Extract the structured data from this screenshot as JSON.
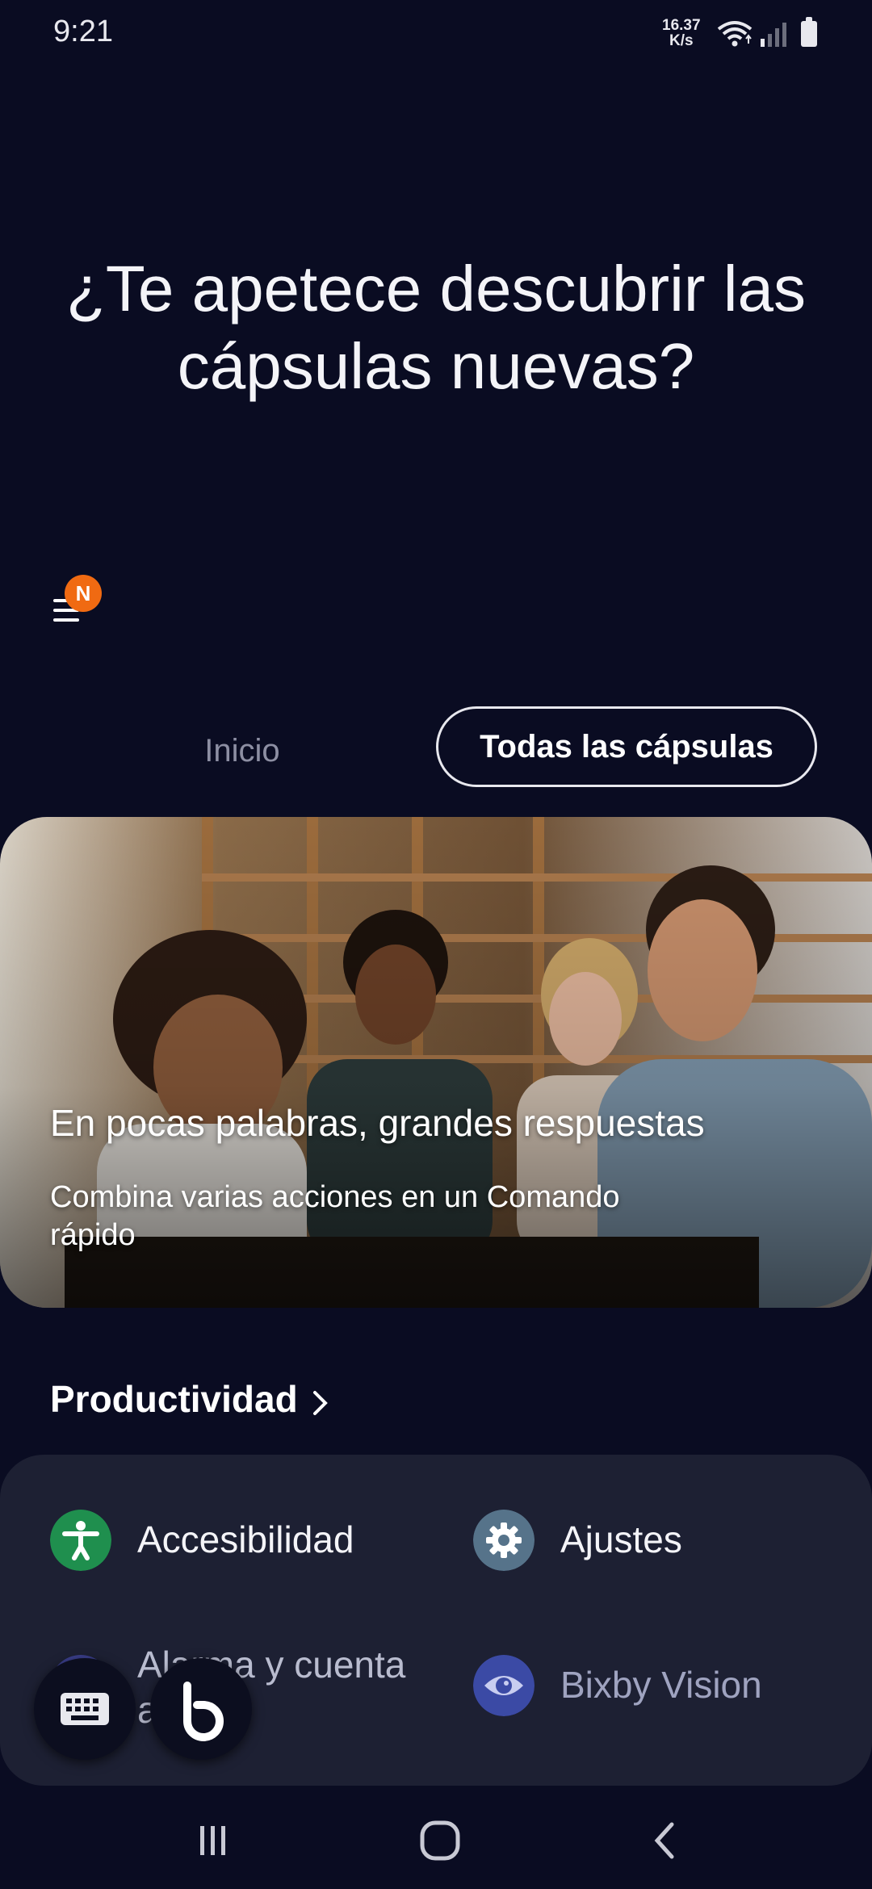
{
  "status_bar": {
    "time": "9:21",
    "net_speed_value": "16.37",
    "net_speed_unit": "K/s",
    "icons": [
      "wifi-icon",
      "signal-icon",
      "battery-icon"
    ]
  },
  "headline": "¿Te apetece descubrir las cápsulas nuevas?",
  "menu": {
    "badge": "N"
  },
  "tabs": [
    {
      "label": "Inicio",
      "selected": false
    },
    {
      "label": "Todas las cápsulas",
      "selected": true
    }
  ],
  "banner": {
    "title": "En pocas palabras, grandes respuestas",
    "subtitle": "Combina varias acciones en un Comando rápido"
  },
  "section": {
    "title": "Productividad"
  },
  "capsules": [
    {
      "label": "Accesibilidad",
      "icon": "accessibility-icon",
      "color": "#1f8f4e"
    },
    {
      "label": "Ajustes",
      "icon": "settings-gear-icon",
      "color": "#56738a"
    },
    {
      "label": "Alarma y cuenta atrás",
      "icon": "alarm-icon",
      "color": "#3b3f8c"
    },
    {
      "label": "Bixby Vision",
      "icon": "eye-icon",
      "color": "#3b4aa5"
    }
  ],
  "colors": {
    "background": "#0a0c22",
    "card": "#1d2033",
    "badge": "#f06a12"
  }
}
